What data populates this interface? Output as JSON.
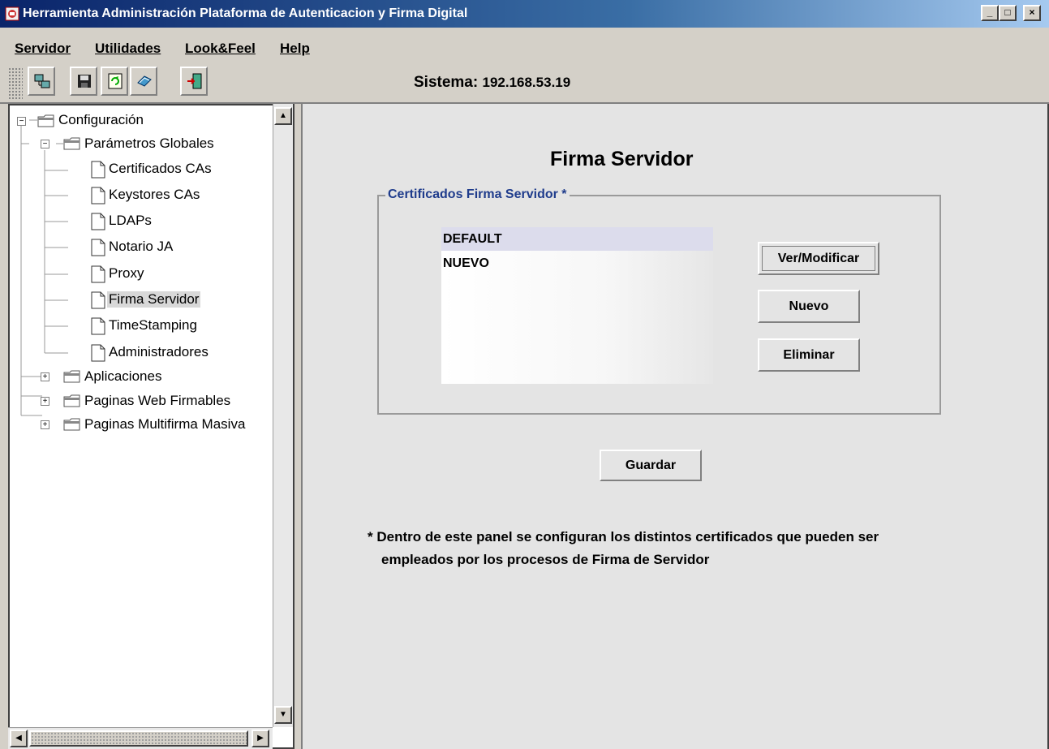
{
  "window": {
    "title": "Herramienta Administración Plataforma de Autenticacion y Firma Digital",
    "controls": {
      "minimize": "_",
      "maximize": "□",
      "close": "×"
    }
  },
  "menu": {
    "items": [
      "Servidor",
      "Utilidades",
      "Look&Feel",
      "Help"
    ]
  },
  "toolbar": {
    "buttons": [
      "connect-icon",
      "save-icon",
      "refresh-icon",
      "book-icon",
      "exit-door-icon"
    ],
    "system_label": "Sistema:",
    "system_value": "192.168.53.19"
  },
  "tree": {
    "root": "Configuración",
    "global": "Parámetros Globales",
    "children": [
      "Certificados CAs",
      "Keystores CAs",
      "LDAPs",
      "Notario JA",
      "Proxy",
      "Firma Servidor",
      "TimeStamping",
      "Administradores"
    ],
    "selected": "Firma Servidor",
    "collapsed": [
      "Aplicaciones",
      "Paginas Web Firmables",
      "Paginas Multifirma Masiva"
    ]
  },
  "panel": {
    "title": "Firma Servidor",
    "group_title": "Certificados Firma Servidor *",
    "certificates": [
      "DEFAULT",
      "NUEVO"
    ],
    "selected_certificate": "DEFAULT",
    "buttons": {
      "view_modify": "Ver/Modificar",
      "new": "Nuevo",
      "delete": "Eliminar",
      "save": "Guardar"
    },
    "note_line1": "* Dentro de este panel se configuran los distintos certificados que pueden ser",
    "note_line2": "empleados por los procesos de Firma de Servidor"
  }
}
